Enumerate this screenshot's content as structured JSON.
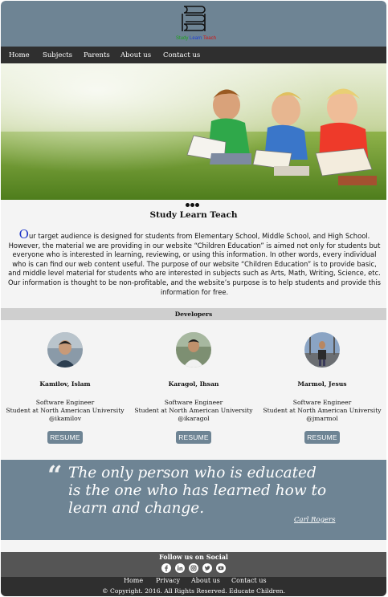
{
  "brand": {
    "logo_words": [
      "Study",
      "Learn",
      "Teach"
    ]
  },
  "nav": {
    "items": [
      "Home",
      "Subjects",
      "Parents",
      "About us",
      "Contact us"
    ]
  },
  "hero": {
    "image": "children-reading-books-on-grass",
    "indicator_count": 3
  },
  "intro": {
    "title": "Study Learn Teach",
    "dropcap": "O",
    "body": "ur target audience is designed for students from Elementary School, Middle School, and High School. However, the material we are providing in our website “Children Education” is aimed not only for students but everyone who is interested in learning, reviewing, or using this information. In other words, every individual who is can find our web content useful. The purpose of our website “Children Education” is to provide basic, and middle level material for students who are interested in subjects such as Arts, Math, Writing, Science, etc. Our information is thought to be non-profitable, and the website’s purpose is to help students and provide this information for free."
  },
  "developers": {
    "heading": "Developers",
    "resume_label": "RESUME",
    "people": [
      {
        "name": "Kamilov, Islam",
        "role": "Software Engineer",
        "school": "Student at North American University",
        "handle": "@ikamilov"
      },
      {
        "name": "Karagol, Ihsan",
        "role": "Software Engineer",
        "school": "Student at North American University",
        "handle": "@ikaragol"
      },
      {
        "name": "Marmol, Jesus",
        "role": "Software Engineer",
        "school": "Student at North American University",
        "handle": "@jmarmol"
      }
    ]
  },
  "quote": {
    "mark": "“",
    "text": "The only person who is educated is the one who has learned how to learn and change.",
    "author": "Carl Rogers"
  },
  "footer": {
    "follow_label": "Follow us on Social",
    "socials": [
      "facebook-icon",
      "linkedin-icon",
      "instagram-icon",
      "twitter-icon",
      "youtube-icon"
    ],
    "links": [
      "Home",
      "Privacy",
      "About us",
      "Contact us"
    ],
    "copyright": "© Copyright. 2016. All Rights Reserved. Educate Children."
  },
  "colors": {
    "header_bg": "#6e8494",
    "nav_bg": "#2f2f2f",
    "dropcap": "#1d35c8",
    "footer_top_bg": "#555555"
  }
}
